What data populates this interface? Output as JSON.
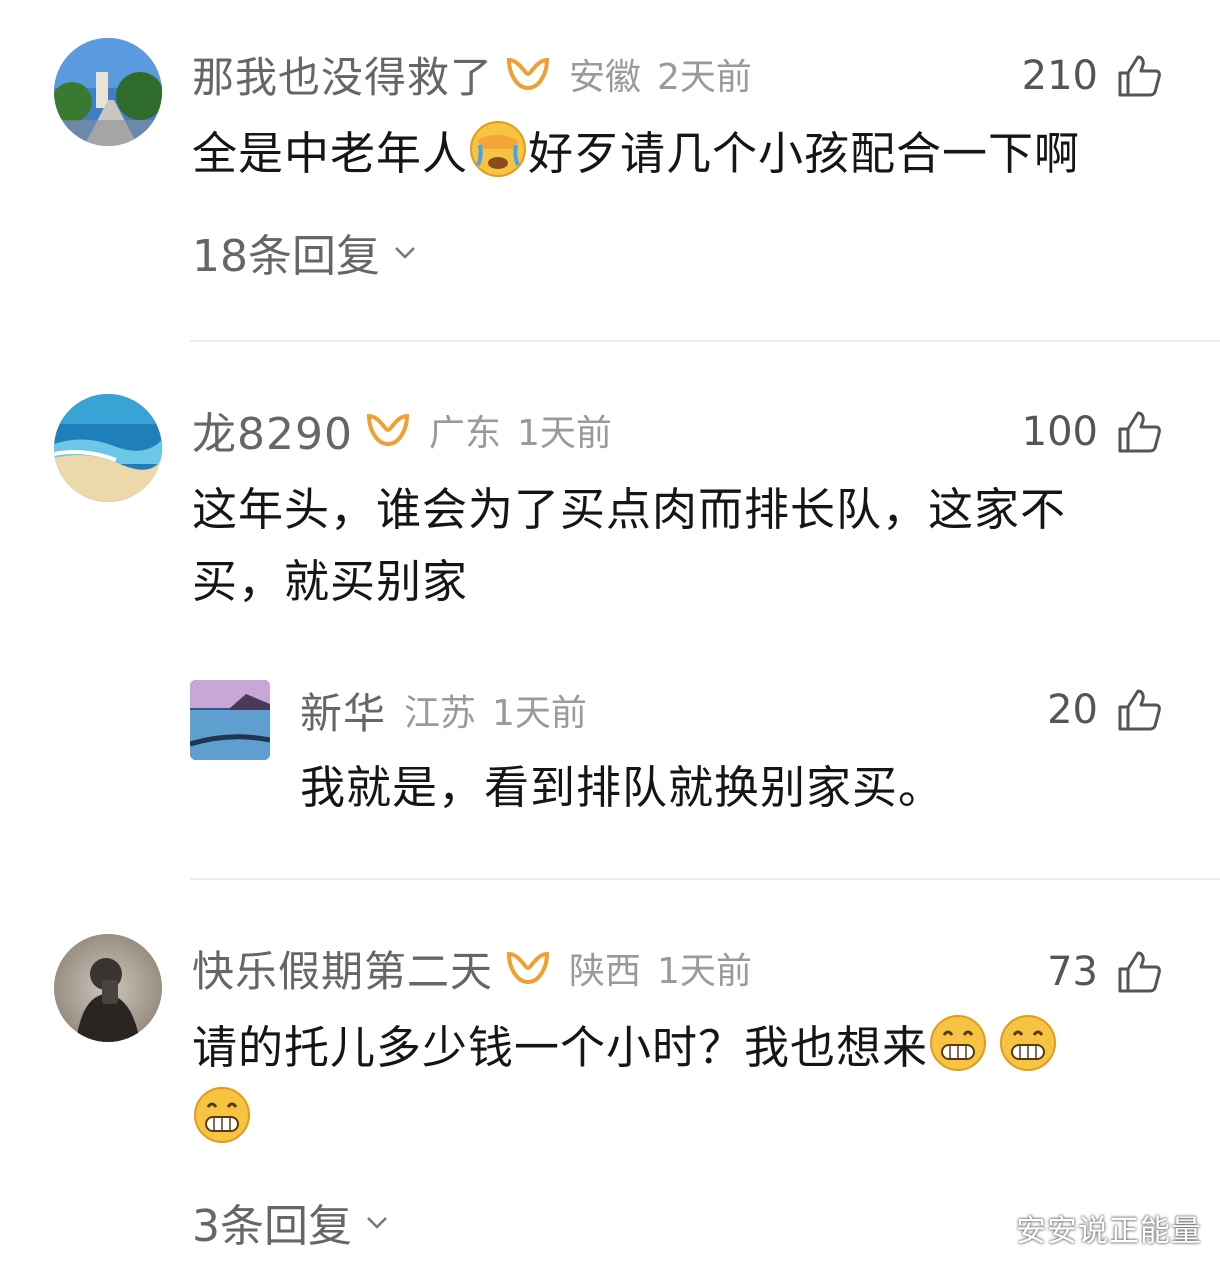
{
  "comments": [
    {
      "username": "那我也没得救了",
      "region": "安徽",
      "time": "2天前",
      "likes": "210",
      "text": "全是中老年人",
      "text_after": "好歹请几个小孩配合一下啊",
      "replies": "18条回复",
      "avatar_icon": "seaside-walkway-avatar",
      "inline_emoji": "face-palm-crying-emoji"
    },
    {
      "username": "龙8290",
      "region": "广东",
      "time": "1天前",
      "likes": "100",
      "text_line1": "这年头，谁会为了买点肉而排长队，这家不",
      "text_line2": "买，就买别家",
      "avatar_icon": "beach-waves-avatar",
      "reply": {
        "username": "新华",
        "region": "江苏",
        "time": "1天前",
        "likes": "20",
        "text": "我就是，看到排队就换别家买。",
        "avatar_icon": "lake-sunset-avatar"
      }
    },
    {
      "username": "快乐假期第二天",
      "region": "陕西",
      "time": "1天前",
      "likes": "73",
      "text": "请的托儿多少钱一个小时？我也想来",
      "replies": "3条回复",
      "avatar_icon": "mirror-selfie-avatar",
      "inline_emoji": "grinning-face-emoji"
    }
  ],
  "watermark": "安安说正能量",
  "colors": {
    "vip_badge": "#f0a030",
    "muted": "#9a9a9a",
    "divider": "#ececec"
  }
}
